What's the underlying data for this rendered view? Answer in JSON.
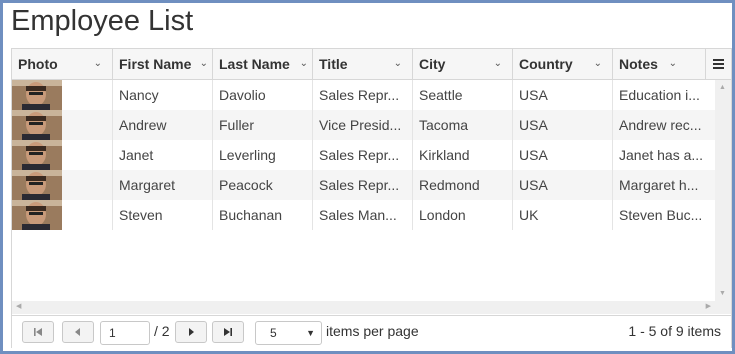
{
  "page": {
    "title": "Employee List"
  },
  "grid": {
    "columns": [
      {
        "label": "Photo"
      },
      {
        "label": "First Name"
      },
      {
        "label": "Last Name"
      },
      {
        "label": "Title"
      },
      {
        "label": "City"
      },
      {
        "label": "Country"
      },
      {
        "label": "Notes"
      }
    ],
    "rows": [
      {
        "first": "Nancy",
        "last": "Davolio",
        "title": "Sales Repr...",
        "city": "Seattle",
        "country": "USA",
        "notes": "Education i..."
      },
      {
        "first": "Andrew",
        "last": "Fuller",
        "title": "Vice Presid...",
        "city": "Tacoma",
        "country": "USA",
        "notes": "Andrew rec..."
      },
      {
        "first": "Janet",
        "last": "Leverling",
        "title": "Sales Repr...",
        "city": "Kirkland",
        "country": "USA",
        "notes": "Janet has a..."
      },
      {
        "first": "Margaret",
        "last": "Peacock",
        "title": "Sales Repr...",
        "city": "Redmond",
        "country": "USA",
        "notes": "Margaret h..."
      },
      {
        "first": "Steven",
        "last": "Buchanan",
        "title": "Sales Man...",
        "city": "London",
        "country": "UK",
        "notes": "Steven Buc..."
      }
    ]
  },
  "pager": {
    "current_page": "1",
    "total_pages": "/ 2",
    "page_size": "5",
    "items_per_page_label": "items per page",
    "summary": "1 - 5 of 9 items"
  },
  "colors": {
    "frame": "#6f8fc0",
    "header_bg": "#f6f6f6",
    "alt_row": "#f5f5f5"
  }
}
